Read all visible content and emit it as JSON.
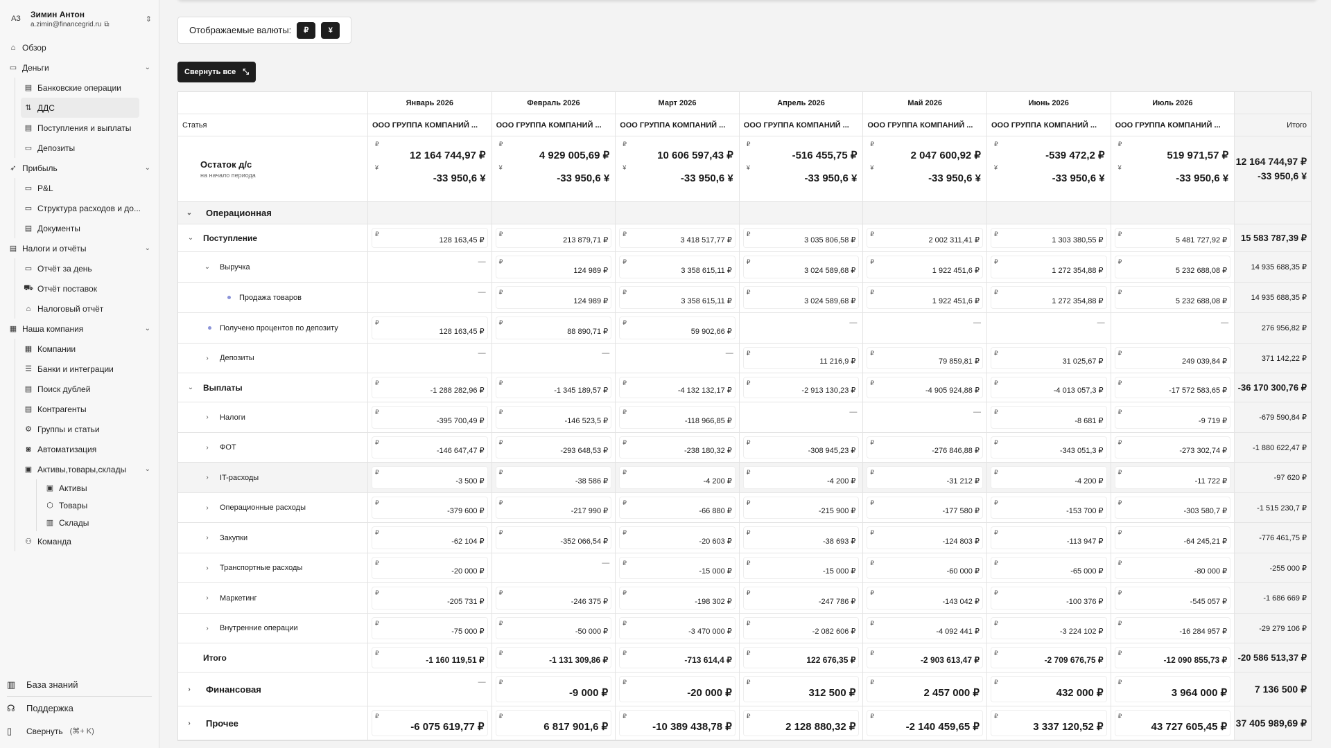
{
  "user": {
    "initials": "АЗ",
    "name": "Зимин Антон",
    "email": "a.zimin@financegrid.ru"
  },
  "nav": {
    "overview": "Обзор",
    "money": "Деньги",
    "money_items": [
      "Банковские операции",
      "ДДС",
      "Поступления и выплаты",
      "Депозиты"
    ],
    "profit": "Прибыль",
    "profit_items": [
      "P&L",
      "Структура расходов и до...",
      "Документы"
    ],
    "taxes": "Налоги и отчёты",
    "taxes_items": [
      "Отчёт за день",
      "Отчёт поставок",
      "Налоговый отчёт"
    ],
    "company": "Наша компания",
    "company_items": [
      "Компании",
      "Банки и интеграции",
      "Поиск дублей",
      "Контрагенты",
      "Группы и статьи",
      "Автоматизация"
    ],
    "assets": "Активы,товары,склады",
    "assets_items": [
      "Активы",
      "Товары",
      "Склады"
    ],
    "team": "Команда",
    "knowledge": "База знаний",
    "support": "Поддержка",
    "collapse": "Свернуть",
    "collapse_kbd": "(⌘+ K)"
  },
  "toolbar": {
    "currencies_label": "Отображаемые валюты:",
    "rub": "₽",
    "cny": "¥",
    "collapse_all": "Свернуть все"
  },
  "table": {
    "months": [
      "Январь 2026",
      "Февраль 2026",
      "Март 2026",
      "Апрель 2026",
      "Май 2026",
      "Июнь 2026",
      "Июль 2026"
    ],
    "article_header": "Статья",
    "company": "ООО ГРУППА КОМПАНИЙ ...",
    "total_header": "Итого",
    "rub": "₽",
    "cny": "¥",
    "dash": "—",
    "balance": {
      "title": "Остаток д/с",
      "subtitle": "на начало периода",
      "rub": [
        "12 164 744,97 ₽",
        "4 929 005,69 ₽",
        "10 606 597,43 ₽",
        "-516 455,75 ₽",
        "2 047 600,92 ₽",
        "-539 472,2 ₽",
        "519 971,57 ₽"
      ],
      "cny": [
        "-33 950,6 ¥",
        "-33 950,6 ¥",
        "-33 950,6 ¥",
        "-33 950,6 ¥",
        "-33 950,6 ¥",
        "-33 950,6 ¥",
        "-33 950,6 ¥"
      ],
      "total_rub": "12 164 744,97 ₽",
      "total_cny": "-33 950,6 ¥"
    },
    "operational": "Операционная",
    "income": {
      "label": "Поступление",
      "values": [
        "128 163,45 ₽",
        "213 879,71 ₽",
        "3 418 517,77 ₽",
        "3 035 806,58 ₽",
        "2 002 311,41 ₽",
        "1 303 380,55 ₽",
        "5 481 727,92 ₽"
      ],
      "total": "15 583 787,39 ₽"
    },
    "revenue": {
      "label": "Выручка",
      "values": [
        null,
        "124 989 ₽",
        "3 358 615,11 ₽",
        "3 024 589,68 ₽",
        "1 922 451,6 ₽",
        "1 272 354,88 ₽",
        "5 232 688,08 ₽"
      ],
      "total": "14 935 688,35 ₽"
    },
    "sales": {
      "label": "Продажа товаров",
      "values": [
        null,
        "124 989 ₽",
        "3 358 615,11 ₽",
        "3 024 589,68 ₽",
        "1 922 451,6 ₽",
        "1 272 354,88 ₽",
        "5 232 688,08 ₽"
      ],
      "total": "14 935 688,35 ₽"
    },
    "interest": {
      "label": "Получено процентов по депозиту",
      "values": [
        "128 163,45 ₽",
        "88 890,71 ₽",
        "59 902,66 ₽",
        null,
        null,
        null,
        null
      ],
      "total": "276 956,82 ₽"
    },
    "deposits": {
      "label": "Депозиты",
      "values": [
        null,
        null,
        null,
        "11 216,9 ₽",
        "79 859,81 ₽",
        "31 025,67 ₽",
        "249 039,84 ₽"
      ],
      "total": "371 142,22 ₽"
    },
    "payments": {
      "label": "Выплаты",
      "values": [
        "-1 288 282,96 ₽",
        "-1 345 189,57 ₽",
        "-4 132 132,17 ₽",
        "-2 913 130,23 ₽",
        "-4 905 924,88 ₽",
        "-4 013 057,3 ₽",
        "-17 572 583,65 ₽"
      ],
      "total": "-36 170 300,76 ₽"
    },
    "taxes": {
      "label": "Налоги",
      "values": [
        "-395 700,49 ₽",
        "-146 523,5 ₽",
        "-118 966,85 ₽",
        null,
        null,
        "-8 681 ₽",
        "-9 719 ₽"
      ],
      "total": "-679 590,84 ₽"
    },
    "payroll": {
      "label": "ФОТ",
      "values": [
        "-146 647,47 ₽",
        "-293 648,53 ₽",
        "-238 180,32 ₽",
        "-308 945,23 ₽",
        "-276 846,88 ₽",
        "-343 051,3 ₽",
        "-273 302,74 ₽"
      ],
      "total": "-1 880 622,47 ₽"
    },
    "it": {
      "label": "IT-расходы",
      "values": [
        "-3 500 ₽",
        "-38 586 ₽",
        "-4 200 ₽",
        "-4 200 ₽",
        "-31 212 ₽",
        "-4 200 ₽",
        "-11 722 ₽"
      ],
      "total": "-97 620 ₽"
    },
    "opex": {
      "label": "Операционные расходы",
      "values": [
        "-379 600 ₽",
        "-217 990 ₽",
        "-66 880 ₽",
        "-215 900 ₽",
        "-177 580 ₽",
        "-153 700 ₽",
        "-303 580,7 ₽"
      ],
      "total": "-1 515 230,7 ₽"
    },
    "purchases": {
      "label": "Закупки",
      "values": [
        "-62 104 ₽",
        "-352 066,54 ₽",
        "-20 603 ₽",
        "-38 693 ₽",
        "-124 803 ₽",
        "-113 947 ₽",
        "-64 245,21 ₽"
      ],
      "total": "-776 461,75 ₽"
    },
    "transport": {
      "label": "Транспортные расходы",
      "values": [
        "-20 000 ₽",
        null,
        "-15 000 ₽",
        "-15 000 ₽",
        "-60 000 ₽",
        "-65 000 ₽",
        "-80 000 ₽"
      ],
      "total": "-255 000 ₽"
    },
    "marketing": {
      "label": "Маркетинг",
      "values": [
        "-205 731 ₽",
        "-246 375 ₽",
        "-198 302 ₽",
        "-247 786 ₽",
        "-143 042 ₽",
        "-100 376 ₽",
        "-545 057 ₽"
      ],
      "total": "-1 686 669 ₽"
    },
    "internal": {
      "label": "Внутренние операции",
      "values": [
        "-75 000 ₽",
        "-50 000 ₽",
        "-3 470 000 ₽",
        "-2 082 606 ₽",
        "-4 092 441 ₽",
        "-3 224 102 ₽",
        "-16 284 957 ₽"
      ],
      "total": "-29 279 106 ₽"
    },
    "op_total": {
      "label": "Итого",
      "values": [
        "-1 160 119,51 ₽",
        "-1 131 309,86 ₽",
        "-713 614,4 ₽",
        "122 676,35 ₽",
        "-2 903 613,47 ₽",
        "-2 709 676,75 ₽",
        "-12 090 855,73 ₽"
      ],
      "total": "-20 586 513,37 ₽"
    },
    "financial": {
      "label": "Финансовая",
      "values": [
        null,
        "-9 000 ₽",
        "-20 000 ₽",
        "312 500 ₽",
        "2 457 000 ₽",
        "432 000 ₽",
        "3 964 000 ₽"
      ],
      "total": "7 136 500 ₽"
    },
    "other": {
      "label": "Прочее",
      "values": [
        "-6 075 619,77 ₽",
        "6 817 901,6 ₽",
        "-10 389 438,78 ₽",
        "2 128 880,32 ₽",
        "-2 140 459,65 ₽",
        "3 337 120,52 ₽",
        "43 727 605,45 ₽"
      ],
      "total": "37 405 989,69 ₽"
    }
  }
}
